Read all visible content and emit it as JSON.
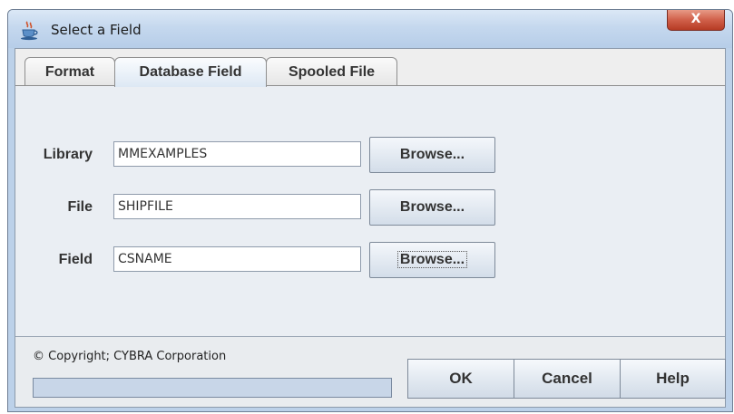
{
  "window": {
    "title": "Select a Field",
    "close_label": "X"
  },
  "tabs": [
    {
      "label": "Format",
      "active": false
    },
    {
      "label": "Database Field",
      "active": true
    },
    {
      "label": "Spooled File",
      "active": false
    }
  ],
  "form": {
    "rows": [
      {
        "label": "Library",
        "value": "MMEXAMPLES",
        "browse_label": "Browse..."
      },
      {
        "label": "File",
        "value": "SHIPFILE",
        "browse_label": "Browse..."
      },
      {
        "label": "Field",
        "value": "CSNAME",
        "browse_label": "Browse..."
      }
    ]
  },
  "footer": {
    "copyright": "© Copyright; CYBRA Corporation",
    "progress_fraction": 0,
    "ok_label": "OK",
    "cancel_label": "Cancel",
    "help_label": "Help"
  },
  "colors": {
    "title_bar": "#c5d8ee",
    "close_button": "#c9503a",
    "panel": "#eaeef3"
  },
  "icons": {
    "title_icon": "java-coffee-cup-icon"
  }
}
